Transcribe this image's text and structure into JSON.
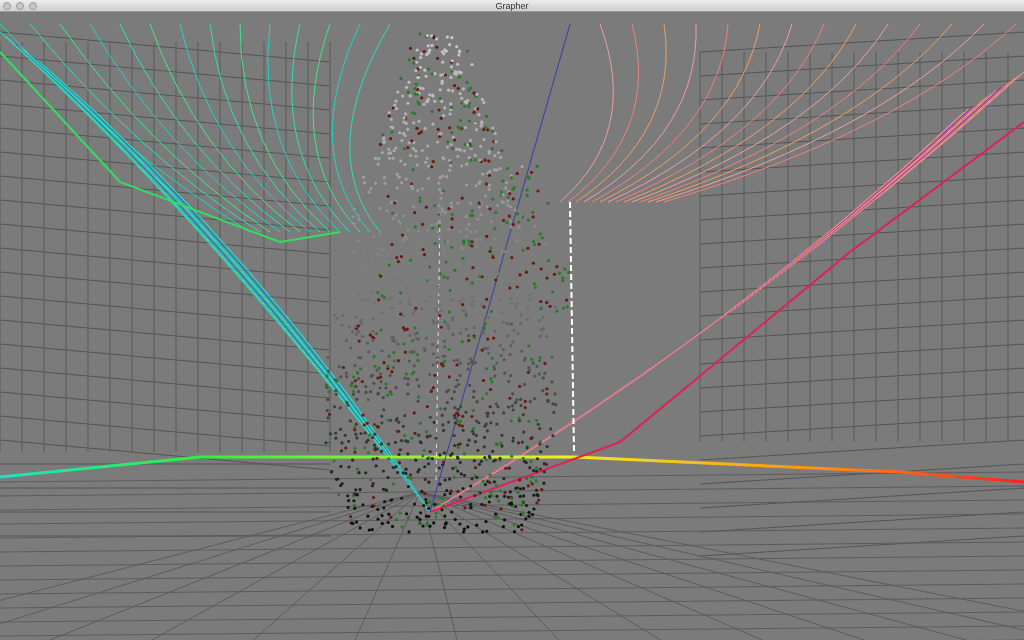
{
  "window": {
    "title": "Grapher"
  }
}
